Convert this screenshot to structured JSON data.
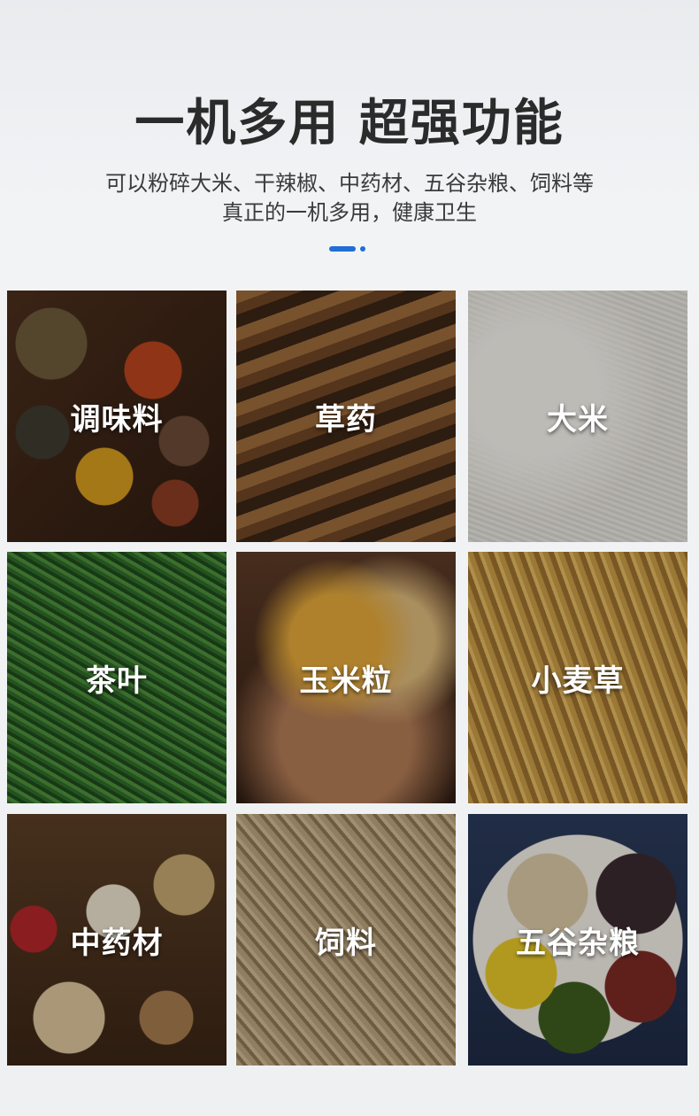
{
  "header": {
    "title": "一机多用 超强功能",
    "subtitle_line1": "可以粉碎大米、干辣椒、中药材、五谷杂粮、饲料等",
    "subtitle_line2": "真正的一机多用，健康卫生"
  },
  "accent_color": "#1f6fd6",
  "tiles": [
    {
      "label": "调味料",
      "icon": "spices-photo"
    },
    {
      "label": "草药",
      "icon": "cordyceps-photo"
    },
    {
      "label": "大米",
      "icon": "rice-photo"
    },
    {
      "label": "茶叶",
      "icon": "tea-leaves-photo"
    },
    {
      "label": "玉米粒",
      "icon": "corn-kernels-photo"
    },
    {
      "label": "小麦草",
      "icon": "wheat-photo"
    },
    {
      "label": "中药材",
      "icon": "chinese-herbs-photo"
    },
    {
      "label": "饲料",
      "icon": "feed-pellets-photo"
    },
    {
      "label": "五谷杂粮",
      "icon": "mixed-grains-photo"
    }
  ]
}
